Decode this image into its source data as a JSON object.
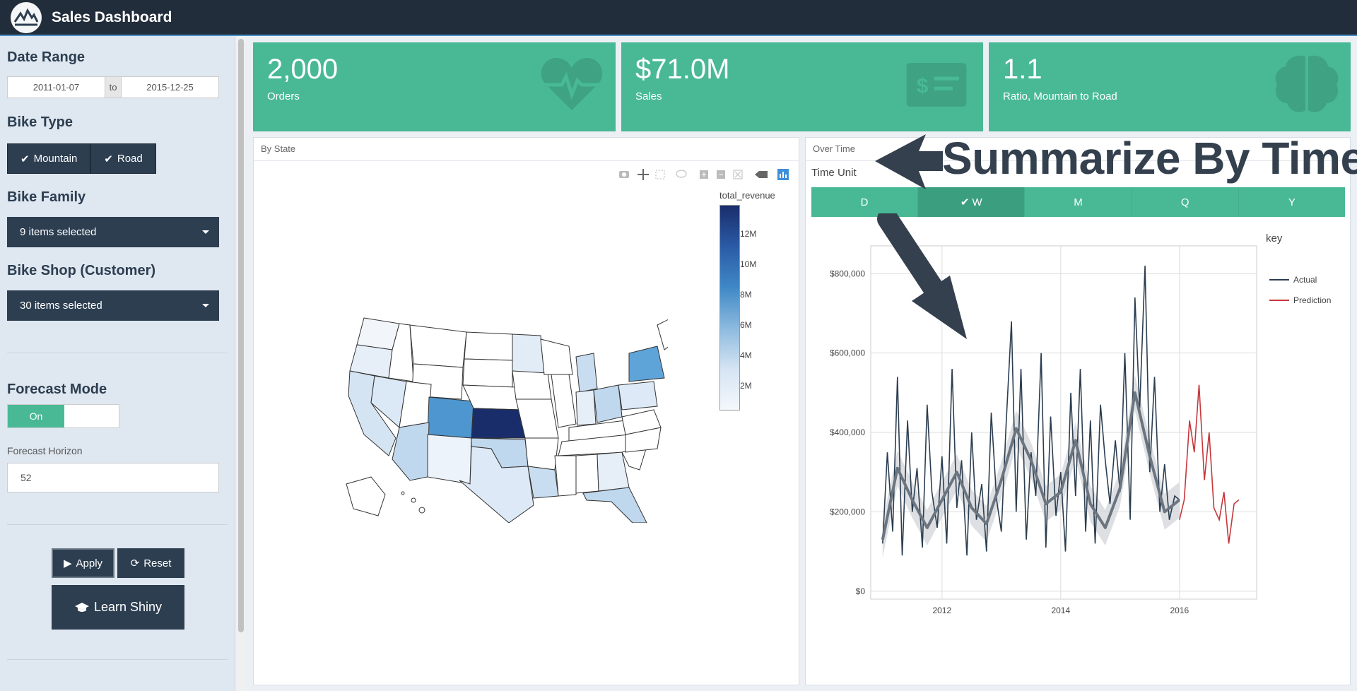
{
  "app": {
    "title": "Sales Dashboard"
  },
  "sidebar": {
    "date_range": {
      "label": "Date Range",
      "start": "2011-01-07",
      "sep": "to",
      "end": "2015-12-25"
    },
    "bike_type": {
      "label": "Bike Type",
      "options": [
        {
          "label": "Mountain",
          "checked": true
        },
        {
          "label": "Road",
          "checked": true
        }
      ]
    },
    "bike_family": {
      "label": "Bike Family",
      "value": "9 items selected"
    },
    "bike_shop": {
      "label": "Bike Shop (Customer)",
      "value": "30 items selected"
    },
    "forecast_mode": {
      "label": "Forecast Mode",
      "switch_label": "On",
      "on": true
    },
    "forecast_horizon": {
      "label": "Forecast Horizon",
      "value": "52"
    },
    "buttons": {
      "apply": "Apply",
      "reset": "Reset",
      "learn": "Learn Shiny"
    }
  },
  "value_boxes": [
    {
      "value": "2,000",
      "caption": "Orders",
      "icon": "heartbeat-icon"
    },
    {
      "value": "$71.0M",
      "caption": "Sales",
      "icon": "money-bill-icon"
    },
    {
      "value": "1.1",
      "caption": "Ratio, Mountain to Road",
      "icon": "brain-icon"
    }
  ],
  "by_state": {
    "title": "By State",
    "toolbar_icons": [
      "camera-icon",
      "pan-icon",
      "box-select-icon",
      "lasso-icon",
      "zoom-in-icon",
      "zoom-out-icon",
      "autoscale-icon",
      "hover-icon",
      "plotly-logo-icon"
    ],
    "colorbar": {
      "title": "total_revenue",
      "ticks": [
        "12M",
        "10M",
        "8M",
        "6M",
        "4M",
        "2M"
      ]
    }
  },
  "over_time": {
    "title": "Over Time",
    "time_unit_label": "Time Unit",
    "time_units": [
      {
        "label": "D",
        "active": false
      },
      {
        "label": "W",
        "active": true
      },
      {
        "label": "M",
        "active": false
      },
      {
        "label": "Q",
        "active": false
      },
      {
        "label": "Y",
        "active": false
      }
    ],
    "annotation": "Summarize By Time"
  },
  "colors": {
    "header": "#222d3b",
    "accent": "#48b994",
    "primary": "#2c3e50",
    "actual": "#2c3e50",
    "prediction": "#c6373b"
  },
  "chart_data": {
    "type": "line",
    "title": "",
    "legend": {
      "title": "key",
      "position": "right",
      "entries": [
        "Actual",
        "Prediction"
      ]
    },
    "x_ticks": [
      "2012",
      "2014",
      "2016"
    ],
    "y_ticks": [
      "$0",
      "$200,000",
      "$400,000",
      "$600,000",
      "$800,000"
    ],
    "xlim": [
      2010.8,
      2017.3
    ],
    "ylim": [
      -20000,
      870000
    ],
    "grid": true,
    "series": [
      {
        "name": "Actual",
        "x": [
          2011.0,
          2011.08,
          2011.17,
          2011.25,
          2011.33,
          2011.42,
          2011.5,
          2011.58,
          2011.67,
          2011.75,
          2011.83,
          2011.92,
          2012.0,
          2012.08,
          2012.17,
          2012.25,
          2012.33,
          2012.42,
          2012.5,
          2012.58,
          2012.67,
          2012.75,
          2012.83,
          2012.92,
          2013.0,
          2013.08,
          2013.17,
          2013.25,
          2013.33,
          2013.42,
          2013.5,
          2013.58,
          2013.67,
          2013.75,
          2013.83,
          2013.92,
          2014.0,
          2014.08,
          2014.17,
          2014.25,
          2014.33,
          2014.42,
          2014.5,
          2014.58,
          2014.67,
          2014.75,
          2014.83,
          2014.92,
          2015.0,
          2015.08,
          2015.17,
          2015.25,
          2015.33,
          2015.42,
          2015.5,
          2015.58,
          2015.67,
          2015.75,
          2015.83,
          2015.92,
          2016.0
        ],
        "values": [
          120000,
          350000,
          150000,
          540000,
          90000,
          430000,
          200000,
          310000,
          110000,
          470000,
          250000,
          160000,
          340000,
          120000,
          560000,
          210000,
          330000,
          90000,
          400000,
          180000,
          270000,
          100000,
          450000,
          230000,
          150000,
          420000,
          680000,
          200000,
          560000,
          130000,
          350000,
          240000,
          600000,
          110000,
          440000,
          190000,
          300000,
          100000,
          500000,
          240000,
          560000,
          150000,
          430000,
          120000,
          470000,
          330000,
          220000,
          380000,
          250000,
          600000,
          180000,
          740000,
          460000,
          820000,
          300000,
          540000,
          200000,
          320000,
          180000,
          240000,
          230000
        ]
      },
      {
        "name": "Prediction",
        "x": [
          2016.0,
          2016.08,
          2016.17,
          2016.25,
          2016.33,
          2016.42,
          2016.5,
          2016.58,
          2016.67,
          2016.75,
          2016.83,
          2016.92,
          2017.0
        ],
        "values": [
          180000,
          230000,
          430000,
          350000,
          520000,
          280000,
          400000,
          210000,
          180000,
          250000,
          120000,
          220000,
          230000
        ]
      }
    ],
    "trend": {
      "x": [
        2011.0,
        2011.25,
        2011.5,
        2011.75,
        2012.0,
        2012.25,
        2012.5,
        2012.75,
        2013.0,
        2013.25,
        2013.5,
        2013.75,
        2014.0,
        2014.25,
        2014.5,
        2014.75,
        2015.0,
        2015.25,
        2015.5,
        2015.75,
        2016.0
      ],
      "values": [
        130000,
        310000,
        230000,
        160000,
        230000,
        300000,
        210000,
        170000,
        280000,
        410000,
        330000,
        220000,
        250000,
        380000,
        220000,
        160000,
        260000,
        500000,
        340000,
        200000,
        230000
      ]
    }
  }
}
